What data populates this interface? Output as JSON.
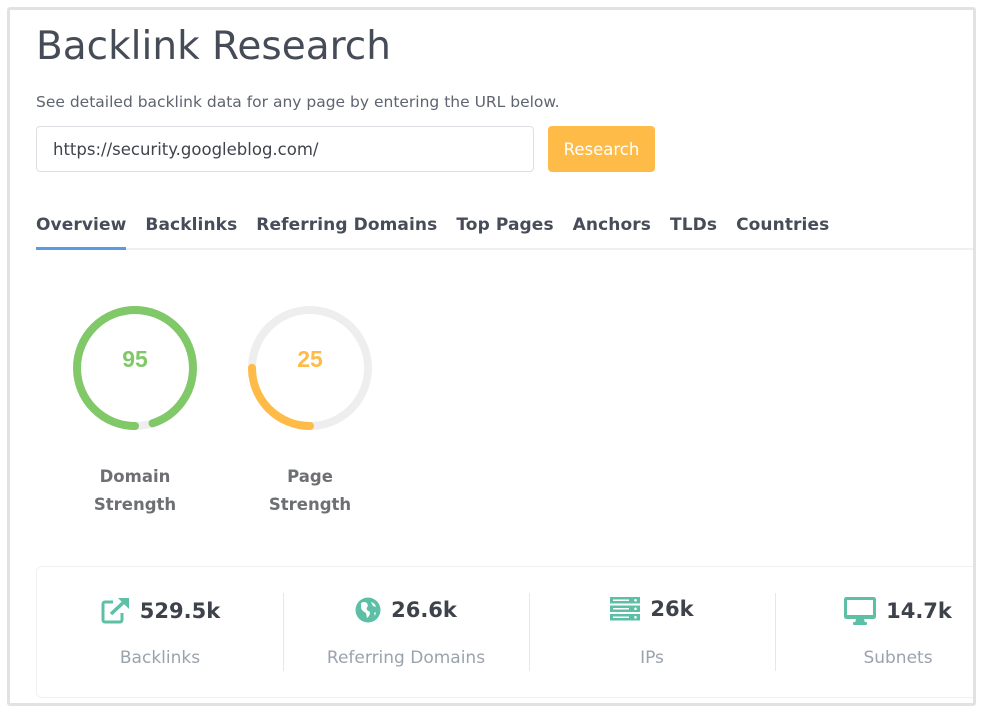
{
  "page": {
    "title": "Backlink Research",
    "subtitle": "See detailed backlink data for any page by entering the URL below."
  },
  "search": {
    "url_value": "https://security.googleblog.com/",
    "button_label": "Research",
    "button_color": "#ffbb47"
  },
  "tabs": [
    {
      "label": "Overview",
      "active": true
    },
    {
      "label": "Backlinks",
      "active": false
    },
    {
      "label": "Referring Domains",
      "active": false
    },
    {
      "label": "Top Pages",
      "active": false
    },
    {
      "label": "Anchors",
      "active": false
    },
    {
      "label": "TLDs",
      "active": false
    },
    {
      "label": "Countries",
      "active": false
    }
  ],
  "gauges": [
    {
      "value": "95",
      "percent": 95,
      "label_line1": "Domain",
      "label_line2": "Strength",
      "color": "#80c868"
    },
    {
      "value": "25",
      "percent": 25,
      "label_line1": "Page",
      "label_line2": "Strength",
      "color": "#ffbb47"
    }
  ],
  "gauge_track_color": "#eeeeee",
  "stats": [
    {
      "icon": "external-link-icon",
      "value": "529.5k",
      "label": "Backlinks"
    },
    {
      "icon": "globe-icon",
      "value": "26.6k",
      "label": "Referring Domains"
    },
    {
      "icon": "server-icon",
      "value": "26k",
      "label": "IPs"
    },
    {
      "icon": "monitor-icon",
      "value": "14.7k",
      "label": "Subnets"
    }
  ],
  "icon_color": "#5dbfa5"
}
